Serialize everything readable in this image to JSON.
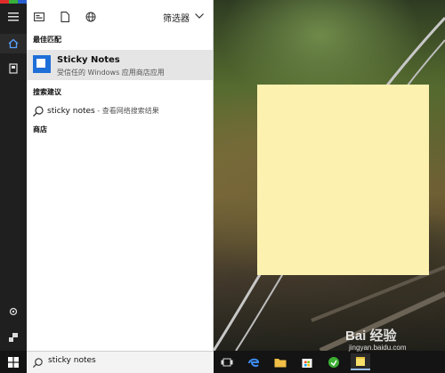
{
  "colors": {
    "accent": "#1f6fd8",
    "sticky": "#fdf1b0",
    "panel": "#ffffff",
    "rail": "#1f1f1f",
    "taskbar": "#141414"
  },
  "search_panel": {
    "filter_label": "筛选器",
    "best_match_heading": "最佳匹配",
    "best_match": {
      "name": "Sticky Notes",
      "desc": "受信任的 Windows 应用商店应用"
    },
    "suggestions_heading": "搜索建议",
    "suggestion": {
      "term": "sticky notes",
      "suffix": " - 查看网络搜索结果"
    },
    "store_heading": "商店"
  },
  "search_box": {
    "value": "sticky notes"
  },
  "watermark": {
    "text": "Bai 经验",
    "url": "jingyan.baidu.com"
  },
  "icons": [
    "hamburger-icon",
    "home-icon",
    "notebook-icon",
    "settings-icon",
    "feedback-icon",
    "windows-start-icon",
    "task-view-icon",
    "edge-icon",
    "file-explorer-icon",
    "store-icon",
    "green-app-icon",
    "sticky-notes-icon"
  ]
}
